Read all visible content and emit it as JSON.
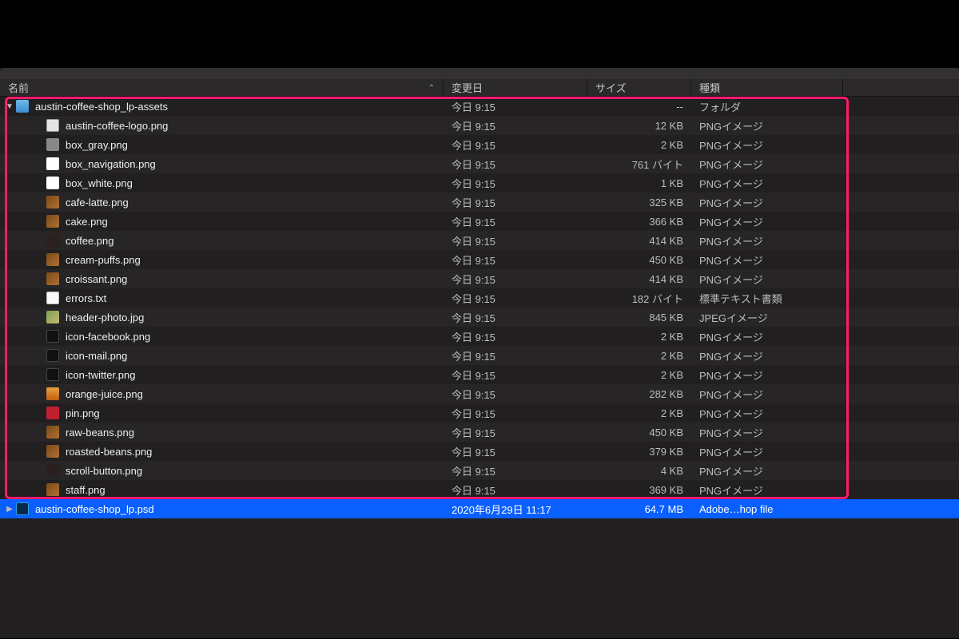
{
  "columns": {
    "name": "名前",
    "date": "変更日",
    "size": "サイズ",
    "kind": "種類"
  },
  "rows": [
    {
      "indent": 0,
      "icon": "folder",
      "disclosure": "open",
      "name": "austin-coffee-shop_lp-assets",
      "date": "今日 9:15",
      "size": "--",
      "kind": "フォルダ",
      "selected": false
    },
    {
      "indent": 1,
      "icon": "png",
      "name": "austin-coffee-logo.png",
      "date": "今日 9:15",
      "size": "12 KB",
      "kind": "PNGイメージ"
    },
    {
      "indent": 1,
      "icon": "thumb-gray",
      "name": "box_gray.png",
      "date": "今日 9:15",
      "size": "2 KB",
      "kind": "PNGイメージ"
    },
    {
      "indent": 1,
      "icon": "thumb-white",
      "name": "box_navigation.png",
      "date": "今日 9:15",
      "size": "761 バイト",
      "kind": "PNGイメージ"
    },
    {
      "indent": 1,
      "icon": "thumb-white",
      "name": "box_white.png",
      "date": "今日 9:15",
      "size": "1 KB",
      "kind": "PNGイメージ"
    },
    {
      "indent": 1,
      "icon": "thumb-brown",
      "name": "cafe-latte.png",
      "date": "今日 9:15",
      "size": "325 KB",
      "kind": "PNGイメージ"
    },
    {
      "indent": 1,
      "icon": "thumb-brown",
      "name": "cake.png",
      "date": "今日 9:15",
      "size": "366 KB",
      "kind": "PNGイメージ"
    },
    {
      "indent": 1,
      "icon": "thumb-dark",
      "name": "coffee.png",
      "date": "今日 9:15",
      "size": "414 KB",
      "kind": "PNGイメージ"
    },
    {
      "indent": 1,
      "icon": "thumb-brown",
      "name": "cream-puffs.png",
      "date": "今日 9:15",
      "size": "450 KB",
      "kind": "PNGイメージ"
    },
    {
      "indent": 1,
      "icon": "thumb-brown",
      "name": "croissant.png",
      "date": "今日 9:15",
      "size": "414 KB",
      "kind": "PNGイメージ"
    },
    {
      "indent": 1,
      "icon": "txt",
      "name": "errors.txt",
      "date": "今日 9:15",
      "size": "182 バイト",
      "kind": "標準テキスト書類"
    },
    {
      "indent": 1,
      "icon": "jpg",
      "name": "header-photo.jpg",
      "date": "今日 9:15",
      "size": "845 KB",
      "kind": "JPEGイメージ"
    },
    {
      "indent": 1,
      "icon": "thumb-black",
      "name": "icon-facebook.png",
      "date": "今日 9:15",
      "size": "2 KB",
      "kind": "PNGイメージ"
    },
    {
      "indent": 1,
      "icon": "thumb-black",
      "name": "icon-mail.png",
      "date": "今日 9:15",
      "size": "2 KB",
      "kind": "PNGイメージ"
    },
    {
      "indent": 1,
      "icon": "thumb-black",
      "name": "icon-twitter.png",
      "date": "今日 9:15",
      "size": "2 KB",
      "kind": "PNGイメージ"
    },
    {
      "indent": 1,
      "icon": "thumb-orange",
      "name": "orange-juice.png",
      "date": "今日 9:15",
      "size": "282 KB",
      "kind": "PNGイメージ"
    },
    {
      "indent": 1,
      "icon": "thumb-red",
      "name": "pin.png",
      "date": "今日 9:15",
      "size": "2 KB",
      "kind": "PNGイメージ"
    },
    {
      "indent": 1,
      "icon": "thumb-brown",
      "name": "raw-beans.png",
      "date": "今日 9:15",
      "size": "450 KB",
      "kind": "PNGイメージ"
    },
    {
      "indent": 1,
      "icon": "thumb-brown",
      "name": "roasted-beans.png",
      "date": "今日 9:15",
      "size": "379 KB",
      "kind": "PNGイメージ"
    },
    {
      "indent": 1,
      "icon": "thumb-dark",
      "name": "scroll-button.png",
      "date": "今日 9:15",
      "size": "4 KB",
      "kind": "PNGイメージ"
    },
    {
      "indent": 1,
      "icon": "thumb-brown",
      "name": "staff.png",
      "date": "今日 9:15",
      "size": "369 KB",
      "kind": "PNGイメージ"
    },
    {
      "indent": 0,
      "icon": "psd",
      "name": "austin-coffee-shop_lp.psd",
      "date": "2020年6月29日 11:17",
      "size": "64.7 MB",
      "kind": "Adobe…hop file",
      "selected": true
    }
  ]
}
